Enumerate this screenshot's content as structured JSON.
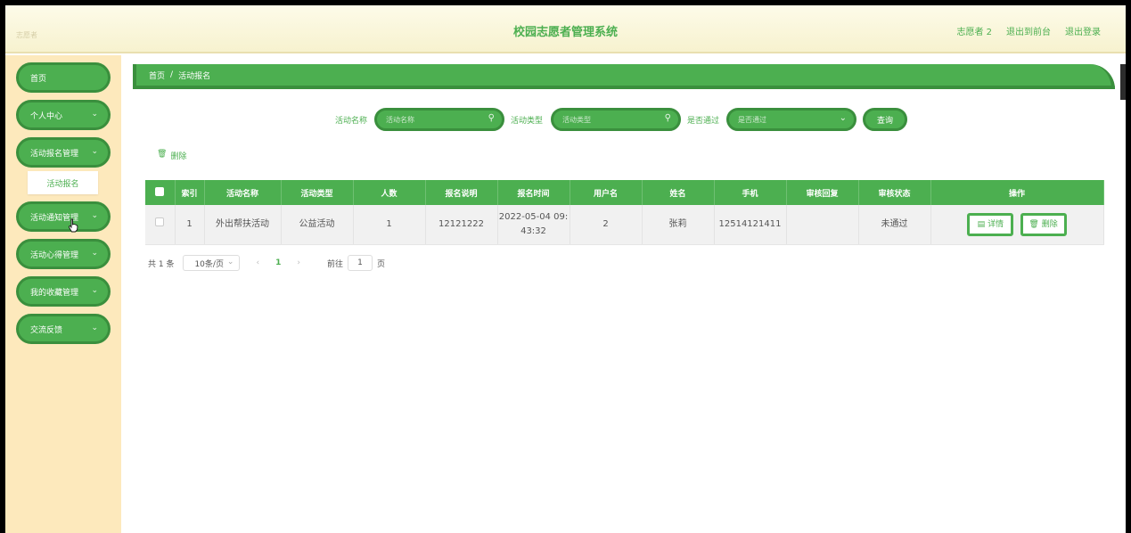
{
  "header": {
    "ghost_text": "志愿者",
    "title": "校园志愿者管理系统",
    "user": "志愿者 2",
    "to_front": "退出到前台",
    "logout": "退出登录"
  },
  "sidebar": {
    "items": [
      {
        "label": "首页"
      },
      {
        "label": "个人中心"
      },
      {
        "label": "活动报名管理"
      },
      {
        "label": "活动通知管理"
      },
      {
        "label": "活动心得管理"
      },
      {
        "label": "我的收藏管理"
      },
      {
        "label": "交流反馈"
      }
    ],
    "submenu_label": "活动报名"
  },
  "breadcrumb": {
    "home": "首页",
    "sep": "/",
    "current": "活动报名"
  },
  "filters": {
    "name_label": "活动名称",
    "name_placeholder": "活动名称",
    "type_label": "活动类型",
    "type_placeholder": "活动类型",
    "pass_label": "是否通过",
    "pass_placeholder": "是否通过",
    "query_button": "查询"
  },
  "actions": {
    "delete_label": "删除"
  },
  "table": {
    "headers": [
      "索引",
      "活动名称",
      "活动类型",
      "人数",
      "报名说明",
      "报名时间",
      "用户名",
      "姓名",
      "手机",
      "审核回复",
      "审核状态",
      "操作"
    ],
    "rows": [
      {
        "index": "1",
        "name": "外出帮扶活动",
        "type": "公益活动",
        "count": "1",
        "desc": "12121222",
        "time_line1": "2022-05-04 09:",
        "time_line2": "43:32",
        "username": "2",
        "realname": "张莉",
        "phone": "12514121411",
        "reply": "",
        "status": "未通过",
        "detail_label": "详情",
        "delete_label": "删除"
      }
    ]
  },
  "pagination": {
    "total": "共 1 条",
    "page_size": "10条/页",
    "current": "1",
    "goto_label": "前往",
    "goto_value": "1",
    "goto_unit": "页"
  },
  "colors": {
    "accent": "#4caf50",
    "accent_dark": "#3a8f3d",
    "sidebar_bg": "#fde9bc"
  }
}
